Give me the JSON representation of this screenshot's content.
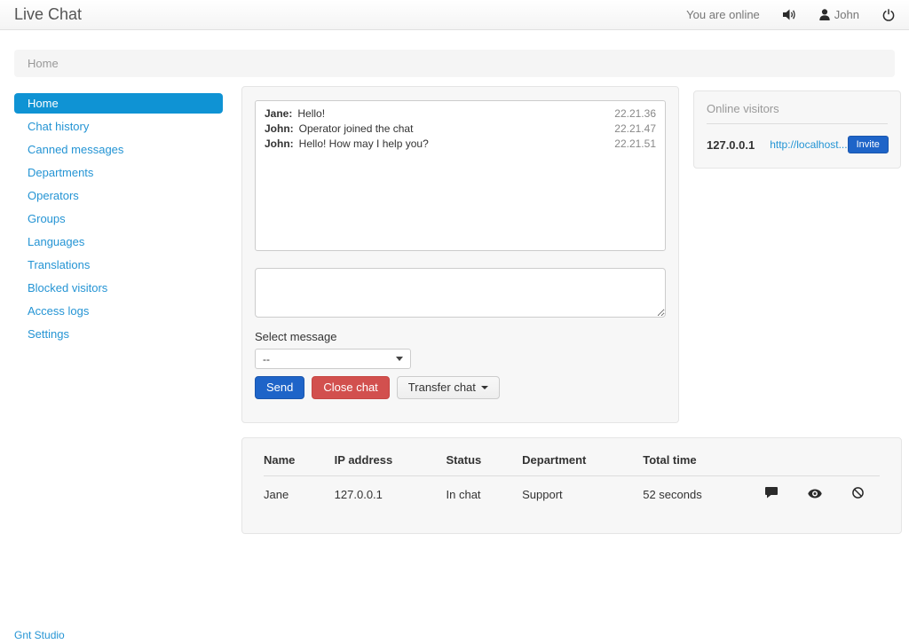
{
  "navbar": {
    "brand": "Live Chat",
    "status_text": "You are online",
    "user_name": "John"
  },
  "breadcrumb": {
    "current": "Home"
  },
  "sidebar": {
    "items": [
      {
        "label": "Home",
        "active": true
      },
      {
        "label": "Chat history",
        "active": false
      },
      {
        "label": "Canned messages",
        "active": false
      },
      {
        "label": "Departments",
        "active": false
      },
      {
        "label": "Operators",
        "active": false
      },
      {
        "label": "Groups",
        "active": false
      },
      {
        "label": "Languages",
        "active": false
      },
      {
        "label": "Translations",
        "active": false
      },
      {
        "label": "Blocked visitors",
        "active": false
      },
      {
        "label": "Access logs",
        "active": false
      },
      {
        "label": "Settings",
        "active": false
      }
    ]
  },
  "chat": {
    "messages": [
      {
        "author": "Jane:",
        "text": "Hello!",
        "time": "22.21.36"
      },
      {
        "author": "John:",
        "text": "Operator joined the chat",
        "time": "22.21.47"
      },
      {
        "author": "John:",
        "text": "Hello! How may I help you?",
        "time": "22.21.51"
      }
    ],
    "input_value": "",
    "select_label": "Select message",
    "select_value": "--",
    "send_label": "Send",
    "close_label": "Close chat",
    "transfer_label": "Transfer chat"
  },
  "online_visitors": {
    "title": "Online visitors",
    "rows": [
      {
        "ip": "127.0.0.1",
        "url": "http://localhost...",
        "invite_label": "Invite"
      }
    ]
  },
  "visitors_table": {
    "headers": [
      "Name",
      "IP address",
      "Status",
      "Department",
      "Total time"
    ],
    "rows": [
      {
        "name": "Jane",
        "ip": "127.0.0.1",
        "status": "In chat",
        "department": "Support",
        "total_time": "52 seconds"
      }
    ],
    "row_icons": [
      "comment-icon",
      "eye-icon",
      "ban-icon"
    ]
  },
  "footer": {
    "link_label": "Gnt Studio"
  },
  "colors": {
    "accent_blue": "#0f93d4",
    "link_blue": "#2494d4",
    "primary_button": "#1e64c8",
    "danger_button": "#d2504e",
    "panel_bg": "#f7f7f7"
  }
}
